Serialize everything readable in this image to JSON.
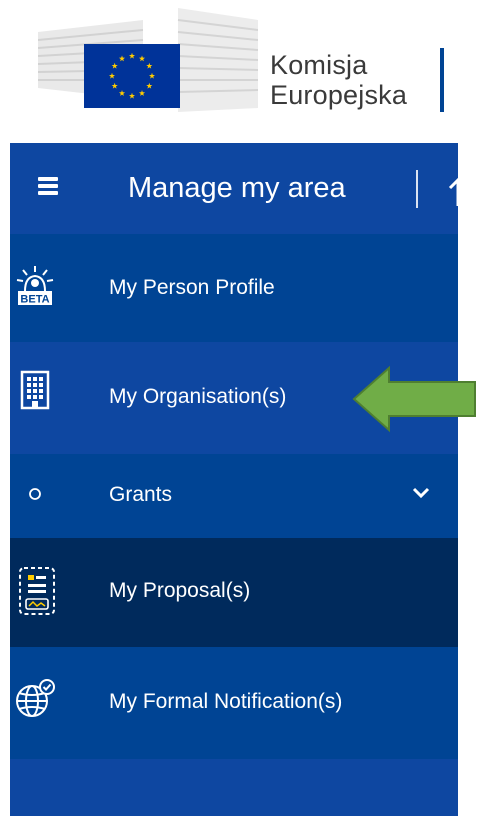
{
  "logo": {
    "line1": "Komisja",
    "line2": "Europejska"
  },
  "sidebar": {
    "title": "Manage my area",
    "items": [
      {
        "label": "My Person Profile",
        "badge": "BETA"
      },
      {
        "label": "My Organisation(s)"
      },
      {
        "label": "Grants"
      },
      {
        "label": "My Proposal(s)"
      },
      {
        "label": "My Formal Notification(s)"
      }
    ]
  },
  "colors": {
    "sidebar_bg": "#004494",
    "top_bar_bg": "#0e47a1",
    "active_item_bg": "#002a5c",
    "arrow": "#70ad47",
    "eu_flag": "#003399",
    "eu_star": "#ffcc00"
  }
}
